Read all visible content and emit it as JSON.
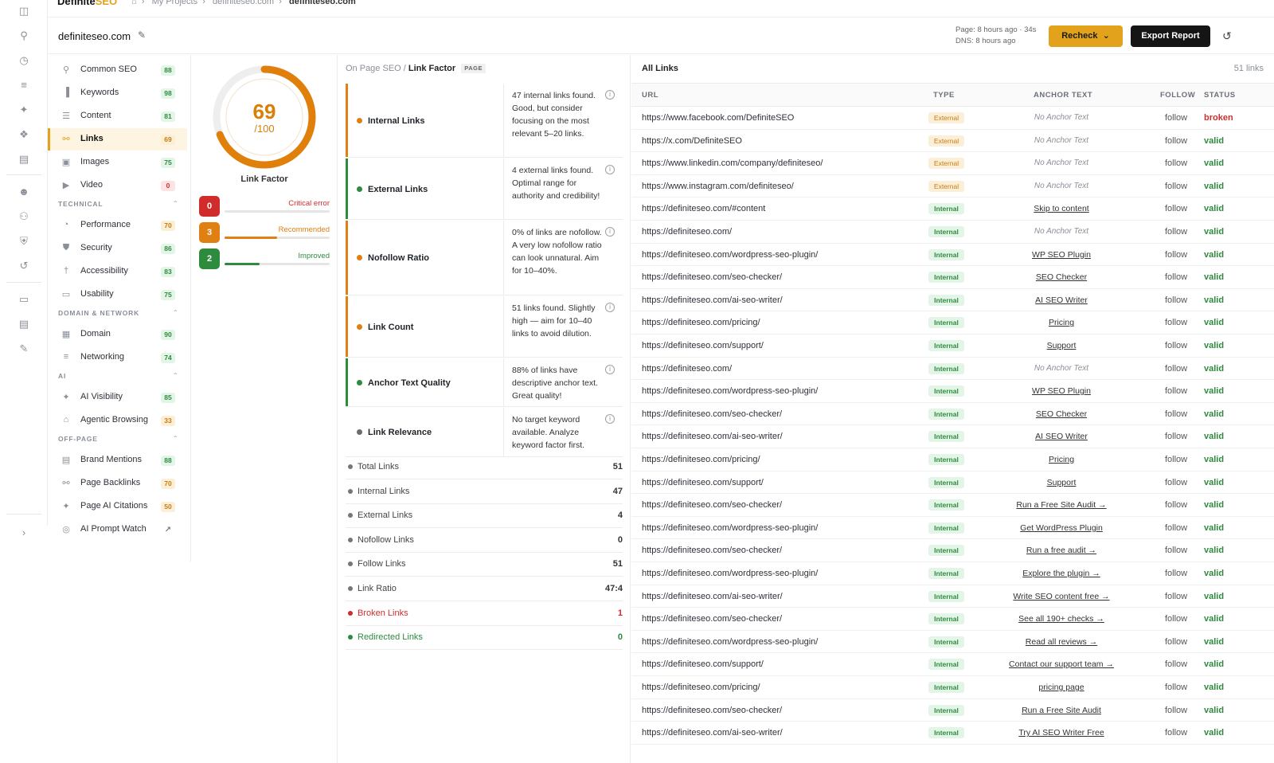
{
  "app": {
    "brand_main": "Definite",
    "brand_accent": "SEO"
  },
  "breadcrumb": [
    "My Projects",
    "definiteseo.com",
    "definiteseo.com"
  ],
  "header": {
    "domain": "definiteseo.com",
    "meta_page": "Page: 8 hours ago · 34s",
    "meta_dns": "DNS: 8 hours ago",
    "recheck_label": "Recheck",
    "export_label": "Export Report"
  },
  "colors": {
    "accent": "#e3a21b",
    "good": "#2e8b3e",
    "warn": "#c97b10",
    "bad": "#d02c2c"
  },
  "nav": {
    "top": [
      {
        "name": "common-seo",
        "icon": "search-icon",
        "label": "Common SEO",
        "score": "88",
        "tone": "green"
      },
      {
        "name": "keywords",
        "icon": "bar-chart-icon",
        "label": "Keywords",
        "score": "98",
        "tone": "green"
      },
      {
        "name": "content",
        "icon": "document-icon",
        "label": "Content",
        "score": "81",
        "tone": "green"
      },
      {
        "name": "links",
        "icon": "link-icon",
        "label": "Links",
        "score": "69",
        "tone": "amber",
        "active": true
      },
      {
        "name": "images",
        "icon": "image-icon",
        "label": "Images",
        "score": "75",
        "tone": "green"
      },
      {
        "name": "video",
        "icon": "video-icon",
        "label": "Video",
        "score": "0",
        "tone": "red"
      }
    ],
    "sections": [
      {
        "title": "TECHNICAL",
        "items": [
          {
            "name": "performance",
            "icon": "gauge-icon",
            "label": "Performance",
            "score": "70",
            "tone": "amber"
          },
          {
            "name": "security",
            "icon": "shield-icon",
            "label": "Security",
            "score": "86",
            "tone": "green"
          },
          {
            "name": "accessibility",
            "icon": "accessibility-icon",
            "label": "Accessibility",
            "score": "83",
            "tone": "green"
          },
          {
            "name": "usability",
            "icon": "devices-icon",
            "label": "Usability",
            "score": "75",
            "tone": "green"
          }
        ]
      },
      {
        "title": "DOMAIN & NETWORK",
        "items": [
          {
            "name": "domain",
            "icon": "building-icon",
            "label": "Domain",
            "score": "90",
            "tone": "green"
          },
          {
            "name": "networking",
            "icon": "server-icon",
            "label": "Networking",
            "score": "74",
            "tone": "green"
          }
        ]
      },
      {
        "title": "AI",
        "items": [
          {
            "name": "ai-visibility",
            "icon": "sparkle-icon",
            "label": "AI Visibility",
            "score": "85",
            "tone": "green"
          },
          {
            "name": "agentic-browsing",
            "icon": "robot-icon",
            "label": "Agentic Browsing",
            "score": "33",
            "tone": "amber"
          }
        ]
      },
      {
        "title": "OFF-PAGE",
        "items": [
          {
            "name": "brand-mentions",
            "icon": "message-icon",
            "label": "Brand Mentions",
            "score": "88",
            "tone": "green"
          },
          {
            "name": "page-backlinks",
            "icon": "link-icon",
            "label": "Page Backlinks",
            "score": "70",
            "tone": "amber"
          },
          {
            "name": "page-ai-citations",
            "icon": "sparkle-icon",
            "label": "Page AI Citations",
            "score": "50",
            "tone": "amber"
          },
          {
            "name": "ai-prompt-watch",
            "icon": "radar-icon",
            "label": "AI Prompt Watch",
            "external": true
          }
        ]
      }
    ]
  },
  "score": {
    "value": "69",
    "max": "/100",
    "fraction": 0.69,
    "label": "Link Factor",
    "counts": [
      {
        "name": "critical",
        "value": "0",
        "label": "Critical error",
        "color": "#d02c2c",
        "fill": 0
      },
      {
        "name": "recommended",
        "value": "3",
        "label": "Recommended",
        "color": "#e07f12",
        "fill": 0.5
      },
      {
        "name": "improved",
        "value": "2",
        "label": "Improved",
        "color": "#2e8b3e",
        "fill": 0.33
      }
    ]
  },
  "factors": {
    "crumb": "On Page SEO /",
    "title": "Link Factor",
    "tag": "PAGE",
    "rows": [
      {
        "name": "Internal Links",
        "status": "warn",
        "desc": "47 internal links found. Good, but consider focusing on the most relevant 5–20 links."
      },
      {
        "name": "External Links",
        "status": "good",
        "desc": "4 external links found. Optimal range for authority and credibility!"
      },
      {
        "name": "Nofollow Ratio",
        "status": "warn",
        "desc": "0% of links are nofollow. A very low nofollow ratio can look unnatural. Aim for 10–40%."
      },
      {
        "name": "Link Count",
        "status": "warn",
        "desc": "51 links found. Slightly high — aim for 10–40 links to avoid dilution."
      },
      {
        "name": "Anchor Text Quality",
        "status": "good",
        "desc": "88% of links have descriptive anchor text. Great quality!"
      },
      {
        "name": "Link Relevance",
        "status": "neutral",
        "desc": "No target keyword available. Analyze keyword factor first."
      }
    ],
    "stats": [
      {
        "label": "Total Links",
        "value": "51",
        "tone": "neutral"
      },
      {
        "label": "Internal Links",
        "value": "47",
        "tone": "neutral"
      },
      {
        "label": "External Links",
        "value": "4",
        "tone": "neutral"
      },
      {
        "label": "Nofollow Links",
        "value": "0",
        "tone": "neutral"
      },
      {
        "label": "Follow Links",
        "value": "51",
        "tone": "neutral"
      },
      {
        "label": "Link Ratio",
        "value": "47:4",
        "tone": "neutral"
      },
      {
        "label": "Broken Links",
        "value": "1",
        "tone": "bad"
      },
      {
        "label": "Redirected Links",
        "value": "0",
        "tone": "good"
      }
    ]
  },
  "links": {
    "title": "All Links",
    "count": "51 links",
    "columns": [
      "URL",
      "TYPE",
      "ANCHOR TEXT",
      "FOLLOW",
      "STATUS"
    ],
    "rows": [
      {
        "url": "https://www.facebook.com/DefiniteSEO",
        "type": "External",
        "anchor": "No Anchor Text",
        "follow": "follow",
        "status": "broken"
      },
      {
        "url": "https://x.com/DefiniteSEO",
        "type": "External",
        "anchor": "No Anchor Text",
        "follow": "follow",
        "status": "valid"
      },
      {
        "url": "https://www.linkedin.com/company/definiteseo/",
        "type": "External",
        "anchor": "No Anchor Text",
        "follow": "follow",
        "status": "valid"
      },
      {
        "url": "https://www.instagram.com/definiteseo/",
        "type": "External",
        "anchor": "No Anchor Text",
        "follow": "follow",
        "status": "valid"
      },
      {
        "url": "https://definiteseo.com/#content",
        "type": "Internal",
        "anchor": "Skip to content",
        "follow": "follow",
        "status": "valid"
      },
      {
        "url": "https://definiteseo.com/",
        "type": "Internal",
        "anchor": "No Anchor Text",
        "follow": "follow",
        "status": "valid"
      },
      {
        "url": "https://definiteseo.com/wordpress-seo-plugin/",
        "type": "Internal",
        "anchor": "WP SEO Plugin",
        "follow": "follow",
        "status": "valid"
      },
      {
        "url": "https://definiteseo.com/seo-checker/",
        "type": "Internal",
        "anchor": "SEO Checker",
        "follow": "follow",
        "status": "valid"
      },
      {
        "url": "https://definiteseo.com/ai-seo-writer/",
        "type": "Internal",
        "anchor": "AI SEO Writer",
        "follow": "follow",
        "status": "valid"
      },
      {
        "url": "https://definiteseo.com/pricing/",
        "type": "Internal",
        "anchor": "Pricing",
        "follow": "follow",
        "status": "valid"
      },
      {
        "url": "https://definiteseo.com/support/",
        "type": "Internal",
        "anchor": "Support",
        "follow": "follow",
        "status": "valid"
      },
      {
        "url": "https://definiteseo.com/",
        "type": "Internal",
        "anchor": "No Anchor Text",
        "follow": "follow",
        "status": "valid"
      },
      {
        "url": "https://definiteseo.com/wordpress-seo-plugin/",
        "type": "Internal",
        "anchor": "WP SEO Plugin",
        "follow": "follow",
        "status": "valid"
      },
      {
        "url": "https://definiteseo.com/seo-checker/",
        "type": "Internal",
        "anchor": "SEO Checker",
        "follow": "follow",
        "status": "valid"
      },
      {
        "url": "https://definiteseo.com/ai-seo-writer/",
        "type": "Internal",
        "anchor": "AI SEO Writer",
        "follow": "follow",
        "status": "valid"
      },
      {
        "url": "https://definiteseo.com/pricing/",
        "type": "Internal",
        "anchor": "Pricing",
        "follow": "follow",
        "status": "valid"
      },
      {
        "url": "https://definiteseo.com/support/",
        "type": "Internal",
        "anchor": "Support",
        "follow": "follow",
        "status": "valid"
      },
      {
        "url": "https://definiteseo.com/seo-checker/",
        "type": "Internal",
        "anchor": "Run a Free Site Audit →",
        "follow": "follow",
        "status": "valid"
      },
      {
        "url": "https://definiteseo.com/wordpress-seo-plugin/",
        "type": "Internal",
        "anchor": "Get WordPress Plugin",
        "follow": "follow",
        "status": "valid"
      },
      {
        "url": "https://definiteseo.com/seo-checker/",
        "type": "Internal",
        "anchor": "Run a free audit →",
        "follow": "follow",
        "status": "valid"
      },
      {
        "url": "https://definiteseo.com/wordpress-seo-plugin/",
        "type": "Internal",
        "anchor": "Explore the plugin →",
        "follow": "follow",
        "status": "valid"
      },
      {
        "url": "https://definiteseo.com/ai-seo-writer/",
        "type": "Internal",
        "anchor": "Write SEO content free →",
        "follow": "follow",
        "status": "valid"
      },
      {
        "url": "https://definiteseo.com/seo-checker/",
        "type": "Internal",
        "anchor": "See all 190+ checks →",
        "follow": "follow",
        "status": "valid"
      },
      {
        "url": "https://definiteseo.com/wordpress-seo-plugin/",
        "type": "Internal",
        "anchor": "Read all reviews →",
        "follow": "follow",
        "status": "valid"
      },
      {
        "url": "https://definiteseo.com/support/",
        "type": "Internal",
        "anchor": "Contact our support team →",
        "follow": "follow",
        "status": "valid"
      },
      {
        "url": "https://definiteseo.com/pricing/",
        "type": "Internal",
        "anchor": "pricing page",
        "follow": "follow",
        "status": "valid"
      },
      {
        "url": "https://definiteseo.com/seo-checker/",
        "type": "Internal",
        "anchor": "Run a Free Site Audit",
        "follow": "follow",
        "status": "valid"
      },
      {
        "url": "https://definiteseo.com/ai-seo-writer/",
        "type": "Internal",
        "anchor": "Try AI SEO Writer Free",
        "follow": "follow",
        "status": "valid"
      }
    ]
  }
}
